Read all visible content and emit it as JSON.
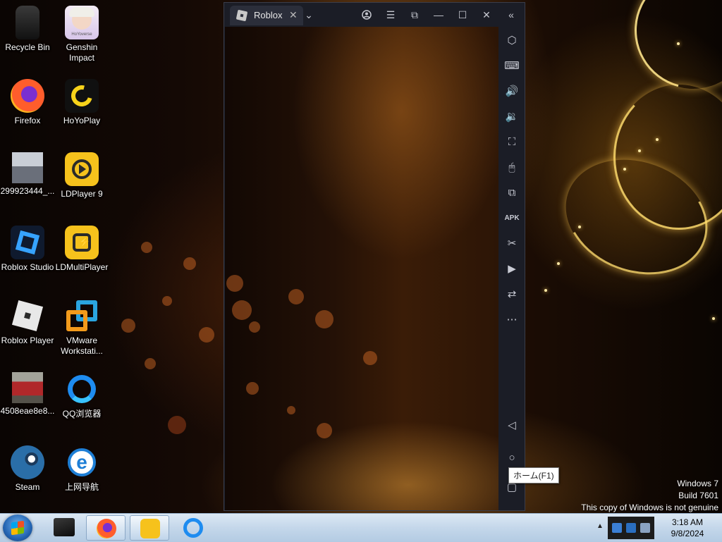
{
  "desktop": {
    "icons": [
      {
        "label": "Recycle Bin",
        "icon": "recycle-bin-icon"
      },
      {
        "label": "Genshin\nImpact",
        "icon": "genshin-impact-icon",
        "badge": "HoYoverse"
      },
      {
        "label": "Firefox",
        "icon": "firefox-icon"
      },
      {
        "label": "HoYoPlay",
        "icon": "hoyoplay-icon"
      },
      {
        "label": "299923444_...",
        "icon": "photo-file-icon"
      },
      {
        "label": "LDPlayer 9",
        "icon": "ldplayer-icon"
      },
      {
        "label": "Roblox Studio",
        "icon": "roblox-studio-icon"
      },
      {
        "label": "LDMultiPlayer",
        "icon": "ldmultiplayer-icon"
      },
      {
        "label": "Roblox Player",
        "icon": "roblox-player-icon"
      },
      {
        "label": "VMware\nWorkstati...",
        "icon": "vmware-icon"
      },
      {
        "label": "4508eae8e8...",
        "icon": "photo-file-icon"
      },
      {
        "label": "QQ浏览器",
        "icon": "qq-browser-icon"
      },
      {
        "label": "Steam",
        "icon": "steam-icon"
      },
      {
        "label": "上网导航",
        "icon": "internet-explorer-icon"
      }
    ]
  },
  "emulator": {
    "tab_label": "Roblox",
    "titlebar_icons": [
      "account-icon",
      "menu-icon",
      "restore-window-icon",
      "minimize-icon",
      "maximize-icon",
      "close-icon",
      "collapse-sidebar-icon"
    ],
    "sidebar_icons": [
      "settings-icon",
      "keyboard-icon",
      "volume-up-icon",
      "volume-down-icon",
      "screenshot-icon",
      "mouse-lock-icon",
      "multi-instance-icon",
      "apk-install-icon",
      "cut-icon",
      "record-icon",
      "sync-icon",
      "more-icon"
    ],
    "nav_icons": [
      "back-icon",
      "home-icon",
      "recents-icon"
    ],
    "tooltip": "ホーム(F1)"
  },
  "watermark": {
    "line1": "Windows 7",
    "line2": "Build 7601",
    "line3": "This copy of Windows is not genuine"
  },
  "taskbar": {
    "items": [
      {
        "icon": "ldmultiplayer-box-icon",
        "active": false
      },
      {
        "icon": "firefox-icon",
        "active": true
      },
      {
        "icon": "ldplayer-icon",
        "active": true
      },
      {
        "icon": "qq-browser-icon",
        "active": false
      }
    ],
    "clock_time": "3:18 AM",
    "clock_date": "9/8/2024"
  },
  "colors": {
    "emulator_bg": "#1b1d26",
    "taskbar_bg": "#c4d7ea"
  }
}
